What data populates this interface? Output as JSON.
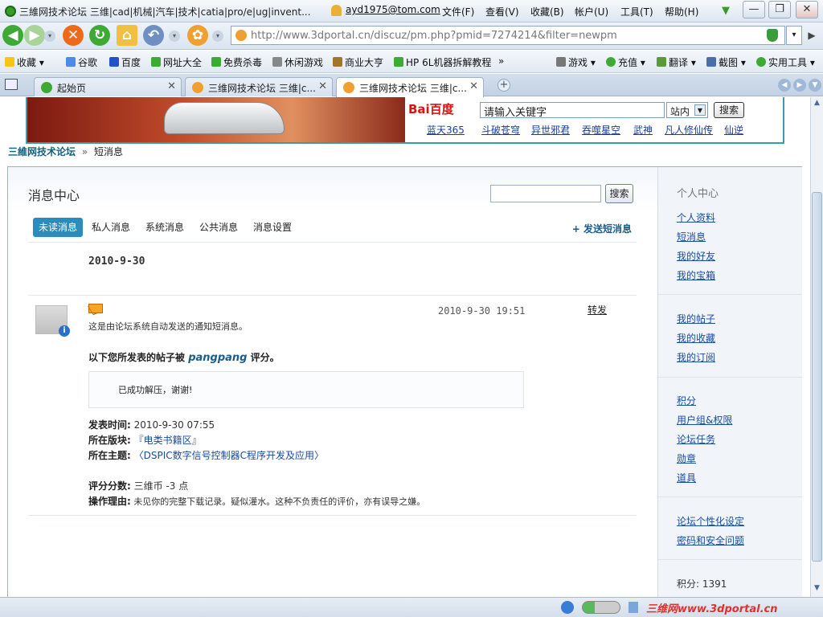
{
  "window": {
    "title": "三維网技术论坛 三维|cad|机械|汽车|技术|catia|pro/e|ug|invent...",
    "user": "ayd1975@tom.com",
    "menus": [
      "文件(F)",
      "查看(V)",
      "收藏(B)",
      "帐户(U)",
      "工具(T)",
      "帮助(H)"
    ],
    "buttons": {
      "minimize": "—",
      "maximize": "❐",
      "close": "✕"
    }
  },
  "nav": {
    "url": "http://www.3dportal.cn/discuz/pm.php?pmid=7274214&filter=newpm"
  },
  "bookmarks": {
    "items": [
      "收藏",
      "谷歌",
      "百度",
      "网址大全",
      "免费杀毒",
      "休闲游戏",
      "商业大亨",
      "HP 6L机器拆解教程"
    ],
    "overflow": "»",
    "right": [
      "游戏",
      "充值",
      "翻译",
      "截图",
      "实用工具"
    ]
  },
  "tabs": [
    {
      "label": "起始页"
    },
    {
      "label": "三维网技术论坛 三维|c..."
    },
    {
      "label": "三维网技术论坛 三维|c..."
    }
  ],
  "banner": {
    "baidu_logo": "Bai百度",
    "search_value": "请输入关键字",
    "select_value": "站内",
    "search_button": "搜索",
    "links": [
      "蓝天365",
      "斗破苍穹",
      "异世邪君",
      "吞噬星空",
      "武神",
      "凡人修仙传",
      "仙逆"
    ]
  },
  "breadcrumb": {
    "home": "三維网技术论坛",
    "sep": "»",
    "current": "短消息"
  },
  "pm": {
    "title": "消息中心",
    "search_button": "搜索",
    "tabs": [
      "未读消息",
      "私人消息",
      "系统消息",
      "公共消息",
      "消息设置"
    ],
    "send": "+ 发送短消息",
    "date_header": "2010-9-30",
    "message": {
      "time": "2010-9-30 19:51",
      "forward": "转发",
      "note": "这是由论坛系统自动发送的通知短消息。",
      "head_prefix": "以下您所发表的帖子被",
      "who": "pangpang",
      "head_suffix": "评分。",
      "quote": "已成功解压，谢谢!",
      "post_time_label": "发表时间:",
      "post_time": "2010-9-30 07:55",
      "forum_label": "所在版块:",
      "forum": "『电类书籍区』",
      "topic_label": "所在主题:",
      "topic": "〈DSPIC数字信号控制器C程序开发及应用〉",
      "score_label": "评分分数:",
      "score": "三维币 -3 点",
      "reason_label": "操作理由:",
      "reason": "未见你的完整下载记录。疑似灌水。这种不负责任的评价，亦有误导之嫌。"
    }
  },
  "sidebar": {
    "heading": "个人中心",
    "group1": [
      "个人资料",
      "短消息",
      "我的好友",
      "我的宝箱"
    ],
    "group2": [
      "我的帖子",
      "我的收藏",
      "我的订阅"
    ],
    "group3": [
      "积分",
      "用户组&权限",
      "论坛任务",
      "勋章",
      "道具"
    ],
    "group4": [
      "论坛个性化设定",
      "密码和安全问题"
    ],
    "credit": "积分: 1391"
  },
  "status": {
    "watermark": "三维网www.3dportal.cn"
  }
}
